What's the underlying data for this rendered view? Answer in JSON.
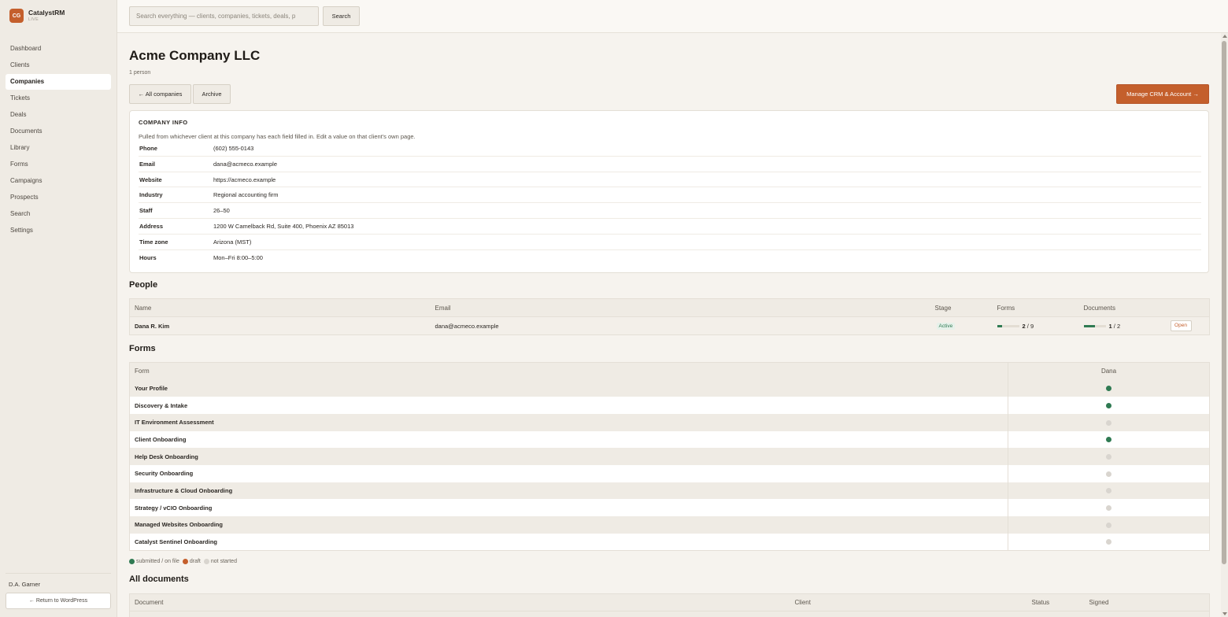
{
  "app": {
    "logo_initials": "CG",
    "name": "CatalystRM",
    "status": "LIVE"
  },
  "sidebar": {
    "items": [
      {
        "label": "Dashboard"
      },
      {
        "label": "Clients"
      },
      {
        "label": "Companies",
        "active": true
      },
      {
        "label": "Tickets"
      },
      {
        "label": "Deals"
      },
      {
        "label": "Documents"
      },
      {
        "label": "Library"
      },
      {
        "label": "Forms"
      },
      {
        "label": "Campaigns"
      },
      {
        "label": "Prospects"
      },
      {
        "label": "Search"
      },
      {
        "label": "Settings"
      }
    ],
    "user": "D.A. Garner",
    "return_label": "← Return to WordPress"
  },
  "search": {
    "placeholder": "Search everything — clients, companies, tickets, deals, p",
    "button": "Search"
  },
  "page": {
    "title": "Acme Company LLC",
    "subtitle": "1 person",
    "all_companies_button": "← All companies",
    "archive_button": "Archive",
    "manage_button": "Manage CRM & Account →"
  },
  "company_info": {
    "heading": "COMPANY INFO",
    "note": "Pulled from whichever client at this company has each field filled in. Edit a value on that client's own page.",
    "rows": [
      {
        "label": "Phone",
        "value": "(602) 555-0143"
      },
      {
        "label": "Email",
        "value": "dana@acmeco.example"
      },
      {
        "label": "Website",
        "value": "https://acmeco.example"
      },
      {
        "label": "Industry",
        "value": "Regional accounting firm"
      },
      {
        "label": "Staff",
        "value": "26–50"
      },
      {
        "label": "Address",
        "value": "1200 W Camelback Rd, Suite 400, Phoenix AZ 85013"
      },
      {
        "label": "Time zone",
        "value": "Arizona (MST)"
      },
      {
        "label": "Hours",
        "value": "Mon–Fri 8:00–5:00"
      }
    ]
  },
  "people": {
    "heading": "People",
    "columns": [
      "Name",
      "Email",
      "Stage",
      "Forms",
      "Documents"
    ],
    "rows": [
      {
        "name": "Dana R. Kim",
        "email": "dana@acmeco.example",
        "stage": "Active",
        "forms_done": "2",
        "forms_total": "9",
        "forms_progress": 0.22,
        "docs_done": "1",
        "docs_total": "2",
        "docs_progress": 0.5,
        "open_label": "Open"
      }
    ]
  },
  "forms": {
    "heading": "Forms",
    "columns": [
      "Form",
      "Dana"
    ],
    "rows": [
      {
        "name": "Your Profile",
        "status": "submitted"
      },
      {
        "name": "Discovery & Intake",
        "status": "submitted"
      },
      {
        "name": "IT Environment Assessment",
        "status": "not-started"
      },
      {
        "name": "Client Onboarding",
        "status": "submitted"
      },
      {
        "name": "Help Desk Onboarding",
        "status": "not-started"
      },
      {
        "name": "Security Onboarding",
        "status": "not-started"
      },
      {
        "name": "Infrastructure & Cloud Onboarding",
        "status": "not-started"
      },
      {
        "name": "Strategy / vCIO Onboarding",
        "status": "not-started"
      },
      {
        "name": "Managed Websites Onboarding",
        "status": "not-started"
      },
      {
        "name": "Catalyst Sentinel Onboarding",
        "status": "not-started"
      }
    ],
    "legend": {
      "submitted": "submitted / on file",
      "draft": "draft",
      "not_started": "not started"
    }
  },
  "documents": {
    "heading": "All documents",
    "columns": [
      "Document",
      "Client",
      "Status",
      "Signed"
    ]
  },
  "colors": {
    "accent": "#c45f2c",
    "submitted": "#2f7a52",
    "not_started": "#d9d5cf"
  }
}
